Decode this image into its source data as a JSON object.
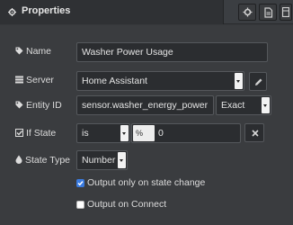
{
  "header": {
    "tab_label": "Properties",
    "tab_icon": "gear-icon",
    "buttons": [
      "settings-icon",
      "document-icon",
      "grid-icon"
    ],
    "more_icon": "chevron-right-icon"
  },
  "form": {
    "name": {
      "label": "Name",
      "icon": "tag-icon",
      "value": "Washer Power Usage"
    },
    "server": {
      "label": "Server",
      "icon": "server-icon",
      "value": "Home Assistant",
      "edit_icon": "pencil-icon"
    },
    "entity_id": {
      "label": "Entity ID",
      "icon": "tag-icon",
      "value": "sensor.washer_energy_power",
      "match": "Exact"
    },
    "if_state": {
      "label": "If State",
      "icon": "checkbox-icon",
      "operator": "is",
      "type_prefix": "0",
      "type_glyph": "%",
      "value": "0",
      "clear_icon": "x-icon"
    },
    "state_type": {
      "label": "State Type",
      "icon": "droplet-icon",
      "value": "Number"
    },
    "output_on_state_change": {
      "label": "Output only on state change",
      "checked": true
    },
    "output_on_connect": {
      "label": "Output on Connect",
      "checked": false
    }
  },
  "colors": {
    "panel_bg": "#3a3c3f",
    "accent": "#3a7be0"
  }
}
